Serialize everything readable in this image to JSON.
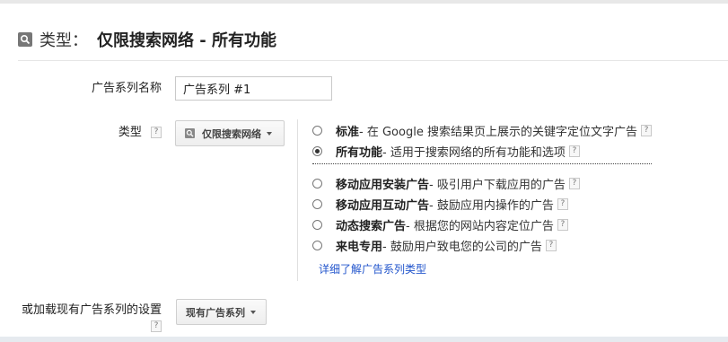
{
  "header": {
    "prefix": "类型：",
    "title": "仅限搜索网络 - 所有功能",
    "icon": "search-icon"
  },
  "campaign_name": {
    "label": "广告系列名称",
    "value": "广告系列 #1"
  },
  "type_section": {
    "label": "类型",
    "help": "?",
    "network_dropdown": "仅限搜索网络",
    "options": [
      {
        "title": "标准",
        "desc": " - 在 Google 搜索结果页上展示的关键字定位文字广告",
        "checked": false
      },
      {
        "title": "所有功能",
        "desc": " - 适用于搜索网络的所有功能和选项",
        "checked": true
      },
      {
        "title": "移动应用安装广告",
        "desc": " - 吸引用户下载应用的广告",
        "checked": false
      },
      {
        "title": "移动应用互动广告",
        "desc": " - 鼓励应用内操作的广告",
        "checked": false
      },
      {
        "title": "动态搜索广告",
        "desc": " - 根据您的网站内容定位广告",
        "checked": false
      },
      {
        "title": "来电专用",
        "desc": " - 鼓励用户致电您的公司的广告",
        "checked": false
      }
    ],
    "learn_more_link": "详细了解广告系列类型"
  },
  "load_existing": {
    "label": "或加载现有广告系列的设置",
    "help": "?",
    "dropdown": "现有广告系列"
  }
}
